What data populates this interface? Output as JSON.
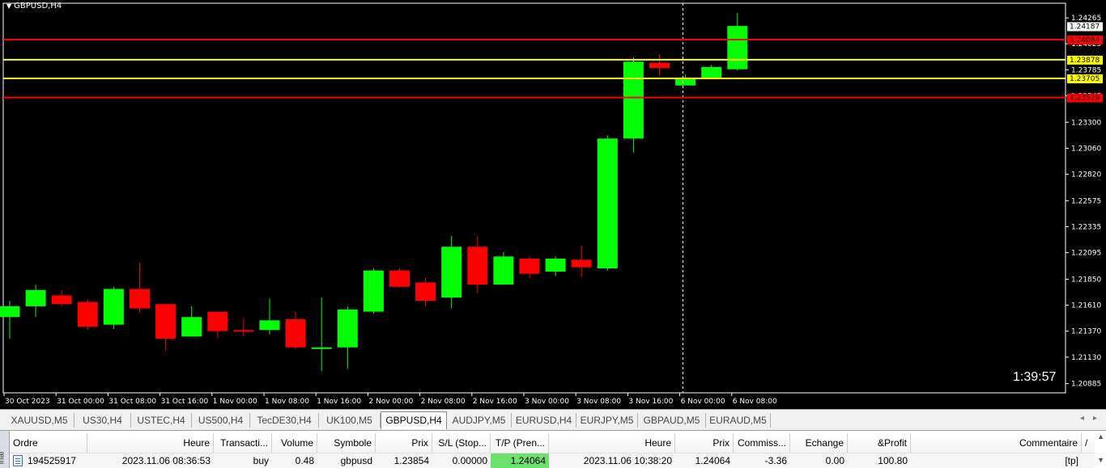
{
  "chart_data": {
    "type": "candlestick",
    "title": "GBPUSD,H4",
    "symbol": "GBPUSD",
    "timeframe": "H4",
    "ylim": [
      1.208,
      1.244
    ],
    "y_ticks": [
      "1.24265",
      "1.24025",
      "1.23785",
      "1.23545",
      "1.23300",
      "1.23060",
      "1.22820",
      "1.22575",
      "1.22335",
      "1.22095",
      "1.21850",
      "1.21610",
      "1.21370",
      "1.21130",
      "1.20885"
    ],
    "x_labels": [
      "30 Oct 2023",
      "31 Oct 00:00",
      "31 Oct 08:00",
      "31 Oct 16:00",
      "1 Nov 00:00",
      "1 Nov 08:00",
      "1 Nov 16:00",
      "2 Nov 00:00",
      "2 Nov 08:00",
      "2 Nov 16:00",
      "3 Nov 00:00",
      "3 Nov 08:00",
      "3 Nov 16:00",
      "6 Nov 00:00",
      "6 Nov 08:00"
    ],
    "candles": [
      {
        "o": 1.215,
        "h": 1.2165,
        "l": 1.213,
        "c": 1.216
      },
      {
        "o": 1.216,
        "h": 1.218,
        "l": 1.215,
        "c": 1.2175
      },
      {
        "o": 1.217,
        "h": 1.2175,
        "l": 1.216,
        "c": 1.2162
      },
      {
        "o": 1.2164,
        "h": 1.2166,
        "l": 1.2138,
        "c": 1.2141
      },
      {
        "o": 1.2143,
        "h": 1.2178,
        "l": 1.2139,
        "c": 1.2176
      },
      {
        "o": 1.2176,
        "h": 1.22,
        "l": 1.2154,
        "c": 1.2158
      },
      {
        "o": 1.2162,
        "h": 1.2162,
        "l": 1.2119,
        "c": 1.213
      },
      {
        "o": 1.2132,
        "h": 1.216,
        "l": 1.2132,
        "c": 1.215
      },
      {
        "o": 1.2155,
        "h": 1.2155,
        "l": 1.2131,
        "c": 1.2137
      },
      {
        "o": 1.2138,
        "h": 1.2149,
        "l": 1.2132,
        "c": 1.2137
      },
      {
        "o": 1.2138,
        "h": 1.2167,
        "l": 1.2134,
        "c": 1.2147
      },
      {
        "o": 1.2148,
        "h": 1.2155,
        "l": 1.212,
        "c": 1.2122
      },
      {
        "o": 1.2122,
        "h": 1.2168,
        "l": 1.21,
        "c": 1.2122
      },
      {
        "o": 1.2122,
        "h": 1.216,
        "l": 1.2102,
        "c": 1.2157
      },
      {
        "o": 1.2155,
        "h": 1.2195,
        "l": 1.2153,
        "c": 1.2193
      },
      {
        "o": 1.2193,
        "h": 1.2195,
        "l": 1.2177,
        "c": 1.2178
      },
      {
        "o": 1.2182,
        "h": 1.2186,
        "l": 1.216,
        "c": 1.2165
      },
      {
        "o": 1.2168,
        "h": 1.2225,
        "l": 1.2158,
        "c": 1.2215
      },
      {
        "o": 1.2215,
        "h": 1.2225,
        "l": 1.2172,
        "c": 1.218
      },
      {
        "o": 1.218,
        "h": 1.221,
        "l": 1.218,
        "c": 1.2206
      },
      {
        "o": 1.2204,
        "h": 1.2206,
        "l": 1.2186,
        "c": 1.219
      },
      {
        "o": 1.2192,
        "h": 1.2206,
        "l": 1.2188,
        "c": 1.2204
      },
      {
        "o": 1.2203,
        "h": 1.2216,
        "l": 1.2187,
        "c": 1.2196
      },
      {
        "o": 1.2195,
        "h": 1.2318,
        "l": 1.2193,
        "c": 1.2315
      },
      {
        "o": 1.2315,
        "h": 1.239,
        "l": 1.2302,
        "c": 1.2386
      },
      {
        "o": 1.2385,
        "h": 1.2393,
        "l": 1.2373,
        "c": 1.238
      },
      {
        "o": 1.2364,
        "h": 1.2374,
        "l": 1.2364,
        "c": 1.237
      },
      {
        "o": 1.2371,
        "h": 1.2383,
        "l": 1.237,
        "c": 1.2381
      },
      {
        "o": 1.2379,
        "h": 1.2431,
        "l": 1.2378,
        "c": 1.2419
      }
    ],
    "hlines": [
      {
        "value": 1.24064,
        "label": "1.24064",
        "color": "#ff0000"
      },
      {
        "value": 1.23878,
        "label": "1.23878",
        "color": "#ffff00"
      },
      {
        "value": 1.23705,
        "label": "1.23705",
        "color": "#ffff00"
      },
      {
        "value": 1.23529,
        "label": "1.23529",
        "color": "#ff0000"
      }
    ],
    "current_price": "1.24187",
    "countdown": "1:39:57",
    "colors": {
      "bull": "#00ff00",
      "bear": "#ff0000",
      "background": "#000000",
      "axis": "#ffffff"
    }
  },
  "tabs": [
    "XAUUSD,M5",
    "US30,H4",
    "USTEC,H4",
    "US500,H4",
    "TecDE30,H4",
    "UK100,M5",
    "GBPUSD,H4",
    "AUDJPY,M5",
    "EURUSD,H4",
    "EURJPY,M5",
    "GBPAUD,M5",
    "EURAUD,M5"
  ],
  "active_tab": "GBPUSD,H4",
  "terminal": {
    "side_label": "inal",
    "headers": [
      "Ordre",
      "Heure",
      "Transacti...",
      "Volume",
      "Symbole",
      "Prix",
      "S/L (Stop...",
      "T/P (Pren...",
      "Heure",
      "Prix",
      "Commiss...",
      "Echange",
      "&Profit",
      "Commentaire"
    ],
    "sort_indicator": "/",
    "row": {
      "ordre": "194525917",
      "heure": "2023.11.06 08:36:53",
      "transaction": "buy",
      "volume": "0.48",
      "symbole": "gbpusd",
      "prix": "1.23854",
      "sl": "0.00000",
      "tp": "1.24064",
      "heure2": "2023.11.06 10:38:20",
      "prix2": "1.24064",
      "commission": "-3.36",
      "echange": "0.00",
      "profit": "100.80",
      "commentaire": "[tp]"
    }
  }
}
